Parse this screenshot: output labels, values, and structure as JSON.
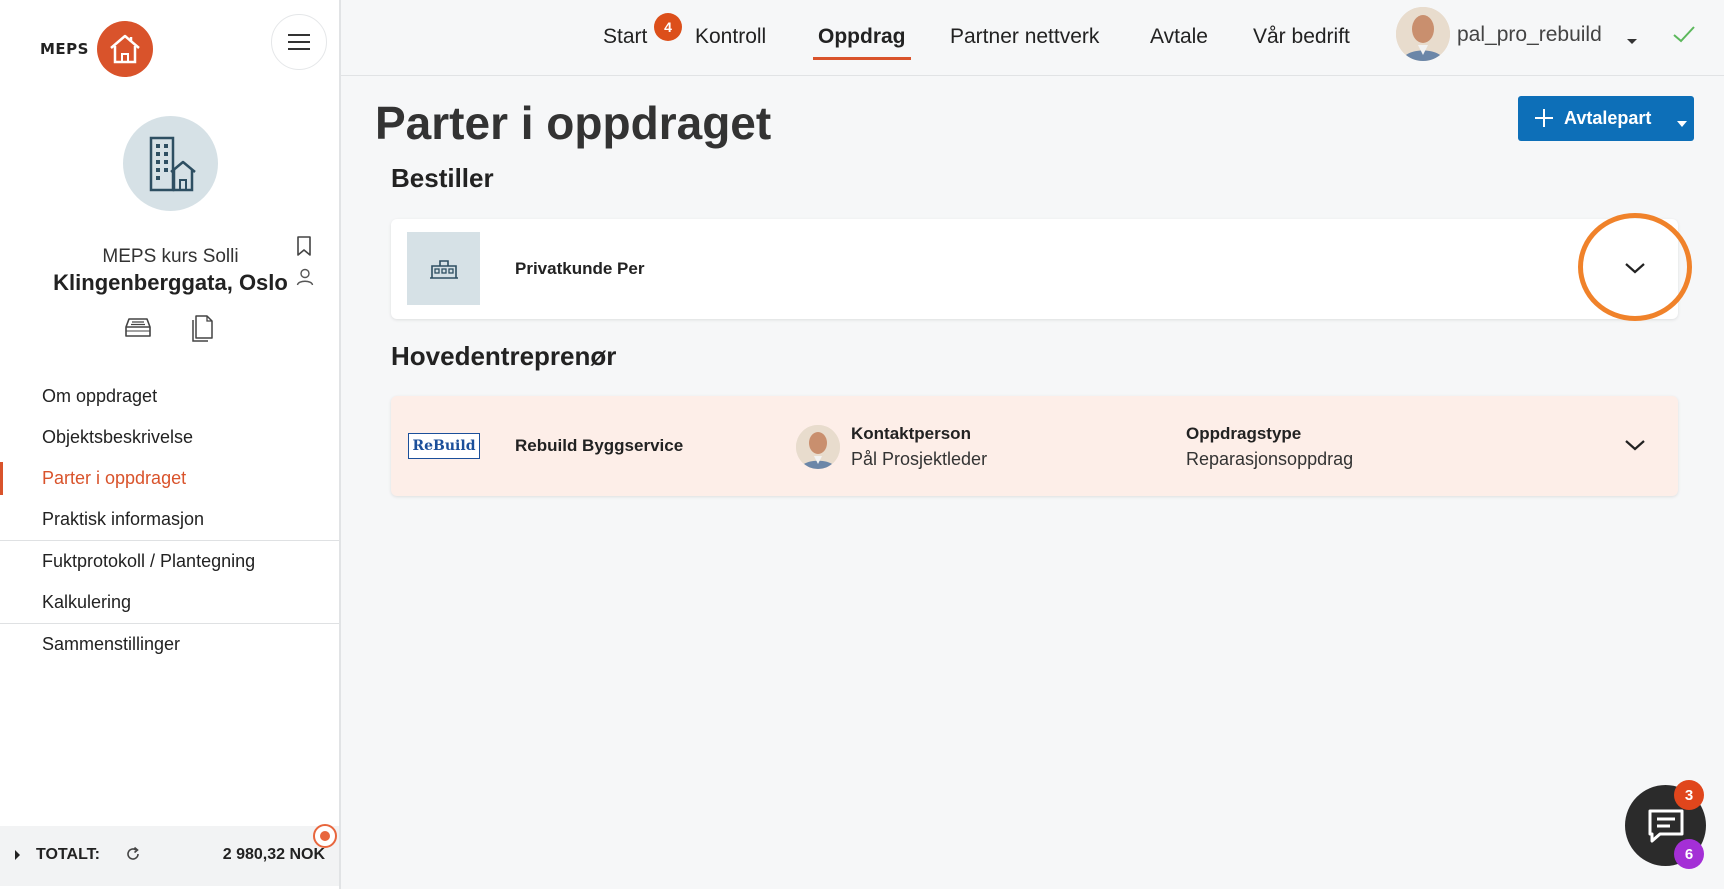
{
  "sidebar": {
    "logo_text": "MEPS",
    "object_name": "MEPS kurs Solli",
    "object_address": "Klingenberggata, Oslo",
    "nav_group1": [
      "Om oppdraget",
      "Objektsbeskrivelse",
      "Parter i oppdraget",
      "Praktisk informasjon"
    ],
    "nav_group2": [
      "Fuktprotokoll / Plantegning",
      "Kalkulering"
    ],
    "nav_group3": [
      "Sammenstillinger"
    ],
    "active_item": "Parter i oppdraget",
    "total_label": "TOTALT:",
    "total_value": "2 980,32 NOK"
  },
  "topbar": {
    "nav": [
      "Start",
      "Kontroll",
      "Oppdrag",
      "Partner nettverk",
      "Avtale",
      "Vår bedrift"
    ],
    "active": "Oppdrag",
    "start_badge": "4",
    "username": "pal_pro_rebuild"
  },
  "main": {
    "title": "Parter i oppdraget",
    "add_button_label": "Avtalepart",
    "section_orderer": "Bestiller",
    "orderer_name": "Privatkunde Per",
    "section_contractor": "Hovedentreprenør",
    "contractor_logo_text": "ReBuild",
    "contractor_name": "Rebuild Byggservice",
    "contact_label": "Kontaktperson",
    "contact_value": "Pål Prosjektleder",
    "type_label": "Oppdragstype",
    "type_value": "Reparasjonsoppdrag"
  },
  "chat": {
    "badge_top": "3",
    "badge_bottom": "6"
  },
  "colors": {
    "accent": "#d9532b",
    "primary_button": "#0d6fb8",
    "highlight_ring": "#f0822a",
    "contractor_card_bg": "#fdeee8",
    "success_check": "#5cb85c"
  }
}
